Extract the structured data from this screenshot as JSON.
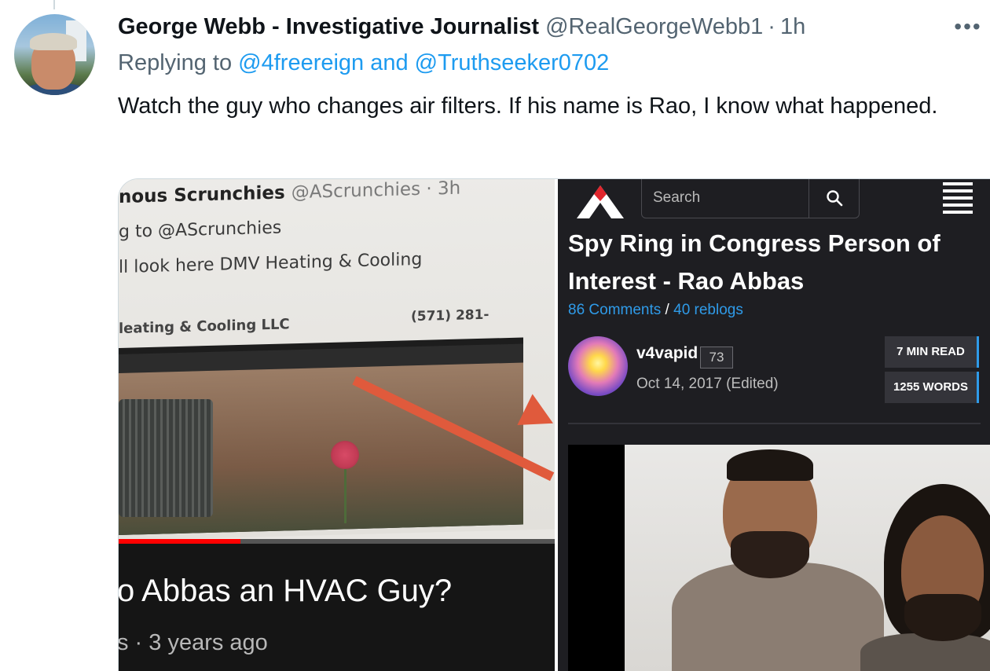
{
  "tweet": {
    "author_name": "George Webb - Investigative Journalist",
    "author_handle": "@RealGeorgeWebb1",
    "separator": "·",
    "time": "1h",
    "more_label": "•••",
    "replying_prefix": "Replying to",
    "replying_to": "@4freereign and @Truthseeker0702",
    "text": "Watch the guy who changes air filters. If his name is Rao, I know what happened."
  },
  "left_media": {
    "screen_author": "nous Scrunchies",
    "screen_handle": "@AScrunchies · 3h",
    "screen_reply": "g to @AScrunchies",
    "screen_text": "ll look here DMV Heating & Cooling",
    "screen_company": "leating & Cooling LLC",
    "screen_phone": "(571) 281-",
    "video_progress": 0.28,
    "video_title": "o Abbas an HVAC Guy?",
    "video_meta": "s · 3 years ago"
  },
  "right_media": {
    "search_placeholder": "Search",
    "post_title": "Spy Ring in Congress Person of Interest - Rao Abbas",
    "comments_label": "86 Comments",
    "stats_separator": " / ",
    "reblogs_label": "40 reblogs",
    "blog_name": "v4vapid",
    "blog_badge": "73",
    "post_date": "Oct 14, 2017 (Edited)",
    "read_time": "7 MIN READ",
    "word_count": "1255 WORDS",
    "accent_color": "#2f9be9"
  },
  "icons": {
    "more": "more-horizontal-icon",
    "search": "search-icon",
    "menu": "hamburger-menu-icon",
    "logo": "site-logo-icon"
  }
}
